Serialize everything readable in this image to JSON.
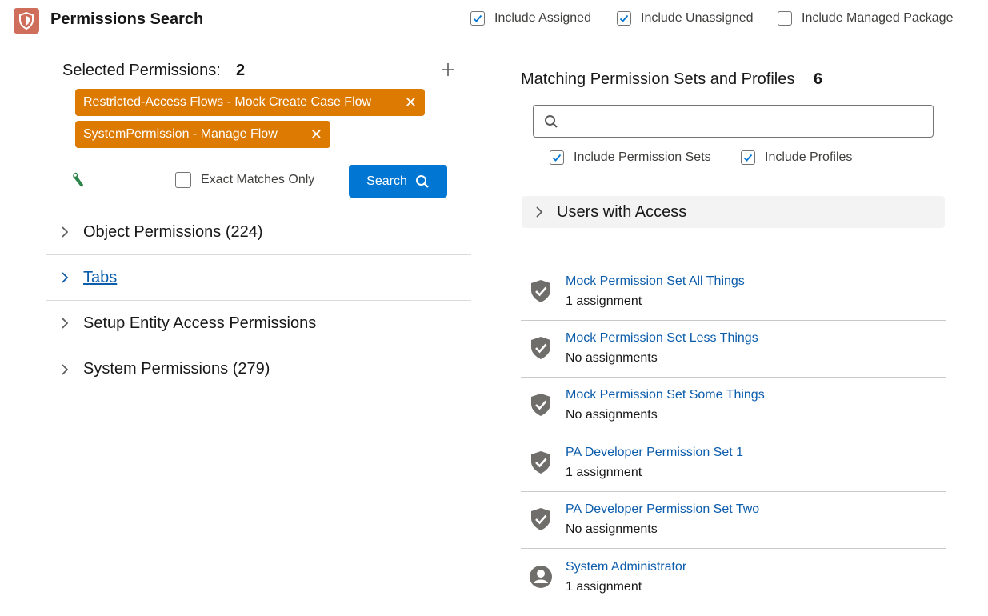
{
  "header": {
    "title": "Permissions Search",
    "filters": [
      {
        "label": "Include Assigned",
        "checked": true
      },
      {
        "label": "Include Unassigned",
        "checked": true
      },
      {
        "label": "Include Managed Package",
        "checked": false
      }
    ]
  },
  "selected": {
    "label": "Selected Permissions:",
    "count": "2",
    "pills": [
      {
        "label": "Restricted-Access Flows - Mock Create Case Flow"
      },
      {
        "label": "SystemPermission - Manage Flow"
      }
    ],
    "exact_label": "Exact Matches Only",
    "search_label": "Search"
  },
  "accordion": [
    {
      "label": "Object Permissions (224)"
    },
    {
      "label": "Tabs"
    },
    {
      "label": "Setup Entity Access Permissions"
    },
    {
      "label": "System Permissions (279)"
    }
  ],
  "matching": {
    "label": "Matching Permission Sets and Profiles",
    "count": "6",
    "search_placeholder": "",
    "include_perm_sets": "Include Permission Sets",
    "include_profiles": "Include Profiles",
    "users_access": "Users with Access"
  },
  "results": [
    {
      "name": "Mock Permission Set All Things",
      "sub": "1 assignment",
      "icon": "shield-check-icon"
    },
    {
      "name": "Mock Permission Set Less Things",
      "sub": "No assignments",
      "icon": "shield-check-icon"
    },
    {
      "name": "Mock Permission Set Some Things",
      "sub": "No assignments",
      "icon": "shield-check-icon"
    },
    {
      "name": "PA Developer Permission Set 1",
      "sub": "1 assignment",
      "icon": "shield-check-icon"
    },
    {
      "name": "PA Developer Permission Set Two",
      "sub": "No assignments",
      "icon": "shield-check-icon"
    },
    {
      "name": "System Administrator",
      "sub": "1 assignment",
      "icon": "user-icon"
    }
  ],
  "colors": {
    "accent": "#0176d3",
    "pill": "#dd7a01",
    "link": "#0b5cab",
    "app_icon": "#cf6f5b"
  }
}
